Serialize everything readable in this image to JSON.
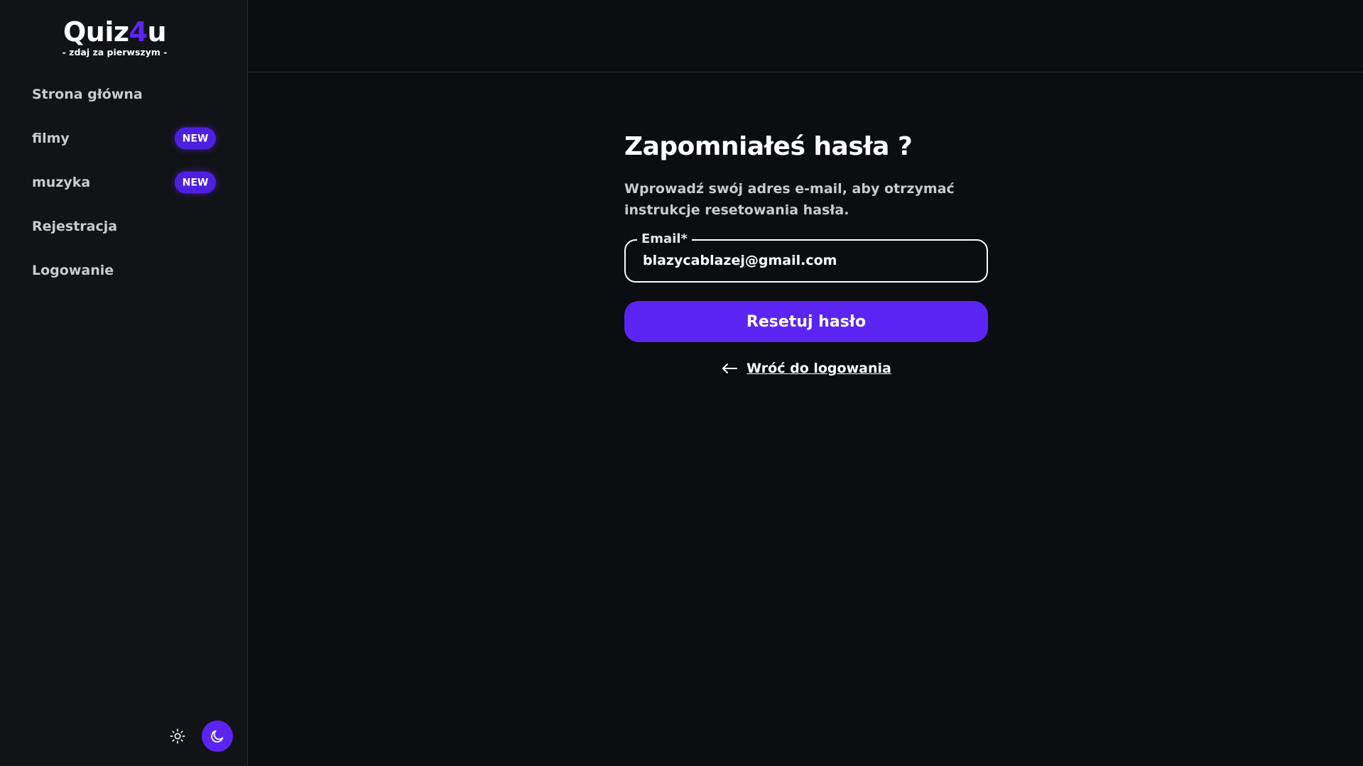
{
  "brand": {
    "name_prefix": "Quiz",
    "name_accent": "4",
    "name_suffix": "u",
    "tagline": "- zdaj za pierwszym -",
    "accent_color": "#5b24f2"
  },
  "sidebar": {
    "items": [
      {
        "label": "Strona główna",
        "badge": null
      },
      {
        "label": "filmy",
        "badge": "NEW"
      },
      {
        "label": "muzyka",
        "badge": "NEW"
      },
      {
        "label": "Rejestracja",
        "badge": null
      },
      {
        "label": "Logowanie",
        "badge": null
      }
    ],
    "theme": {
      "light_icon": "sun-icon",
      "dark_icon": "moon-icon",
      "active": "dark"
    }
  },
  "form": {
    "title": "Zapomniałeś hasła ?",
    "description": "Wprowadź swój adres e-mail, aby otrzymać instrukcje resetowania hasła.",
    "email_label": "Email*",
    "email_value": "blazycablazej@gmail.com",
    "submit_label": "Resetuj hasło",
    "back_label": "Wróć do logowania",
    "back_icon": "arrow-left-icon"
  }
}
